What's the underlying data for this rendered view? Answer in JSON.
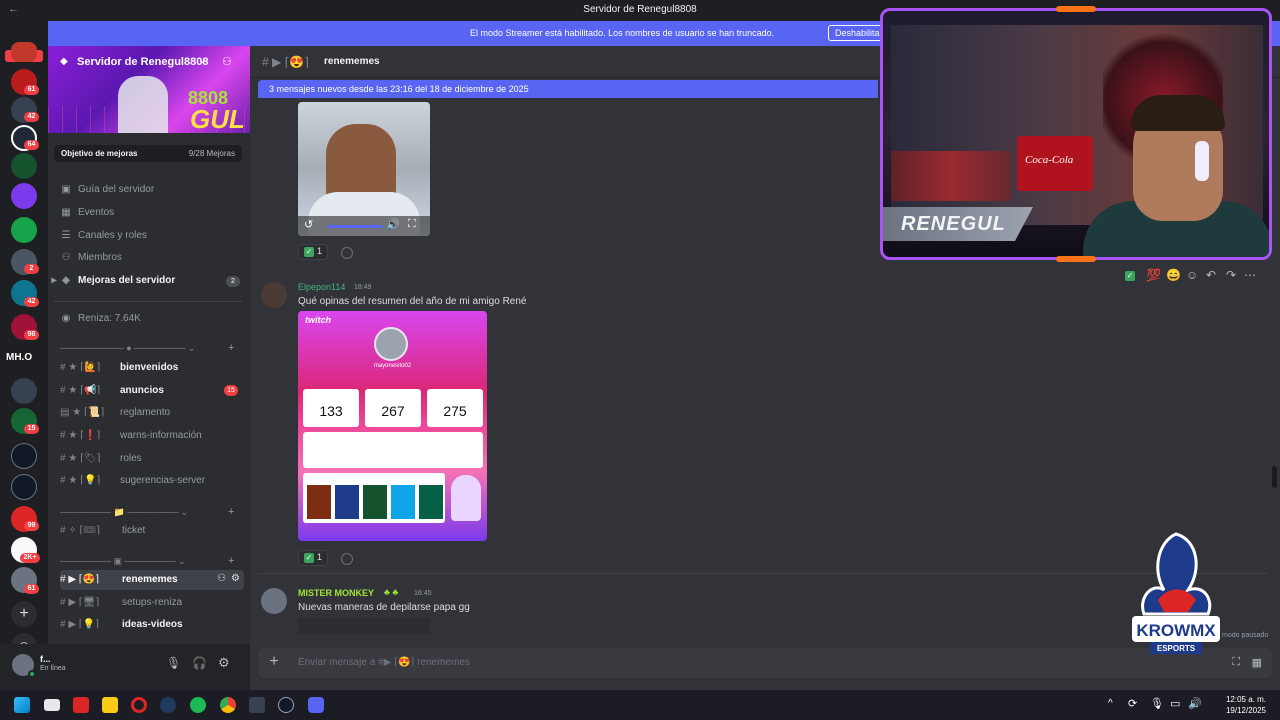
{
  "window": {
    "title": "Servidor de Renegul8808",
    "back_icon": "arrow-left-icon"
  },
  "streamer_bar": {
    "message": "El modo Streamer está habilitado. Los nombres de usuario se han truncado.",
    "button_label": "Deshabilitar"
  },
  "server_rail": {
    "new_label": "NUEVO",
    "text_server": "MH.O",
    "badges": [
      "61",
      "42",
      "64",
      "2",
      "42",
      "96",
      "15",
      "99",
      "2K+",
      "61"
    ]
  },
  "sidebar": {
    "server_name": "Servidor de Renegul8808",
    "banner_text": "GUL",
    "banner_number": "8808",
    "boost_goal": "Objetivo de mejoras",
    "boost_count": "9/28 Mejoras",
    "nav": [
      {
        "label": "Guía del servidor"
      },
      {
        "label": "Eventos"
      },
      {
        "label": "Canales y roles"
      },
      {
        "label": "Miembros"
      },
      {
        "label": "Mejoras del servidor",
        "badge": "2"
      }
    ],
    "currency": "Reniza: 7.64K",
    "channels": [
      {
        "label": "bienvenidos"
      },
      {
        "label": "anuncios",
        "badge": "15"
      },
      {
        "label": "reglamento"
      },
      {
        "label": "warns-información"
      },
      {
        "label": "roles"
      },
      {
        "label": "sugerencias-server"
      },
      {
        "label": "ticket"
      },
      {
        "label": "renememes"
      },
      {
        "label": "setups-reniza"
      },
      {
        "label": "ideas-videos"
      }
    ]
  },
  "user_panel": {
    "name": "f...",
    "status": "En línea"
  },
  "channel_header": {
    "title": "renememes"
  },
  "new_messages_bar": "3 mensajes nuevos desde las 23:16 del 18 de diciembre de 2025",
  "messages": [
    {
      "reaction_count": "1"
    },
    {
      "author": "Elpepon114",
      "time": "18:49",
      "text": "Qué opinas del resumen del año de mi amigo René",
      "card": {
        "brand": "twitch",
        "handle": "mayonesito02",
        "stats": [
          "133",
          "267",
          "275"
        ]
      },
      "reaction_count": "1"
    },
    {
      "author": "MISTER MONKEY",
      "time": "16:45",
      "text": "Nuevas maneras de depilarse papa gg"
    }
  ],
  "composer": {
    "placeholder": "Enviar mensaje a #▶ ⌈😍⌉ renememes"
  },
  "webcam": {
    "name_tag": "RENEGUL",
    "can_brand": "Coca-Cola"
  },
  "watermark": {
    "brand": "KROWMX",
    "sub": "ESPORTS",
    "status": "modo pausado"
  },
  "taskbar": {
    "time": "12:05 a. m.",
    "date": "19/12/2025"
  },
  "colors": {
    "accent": "#5865f2",
    "online": "#23a55a",
    "danger": "#f23f43",
    "username_green": "#43b581",
    "username_monkey": "#a3e635"
  }
}
